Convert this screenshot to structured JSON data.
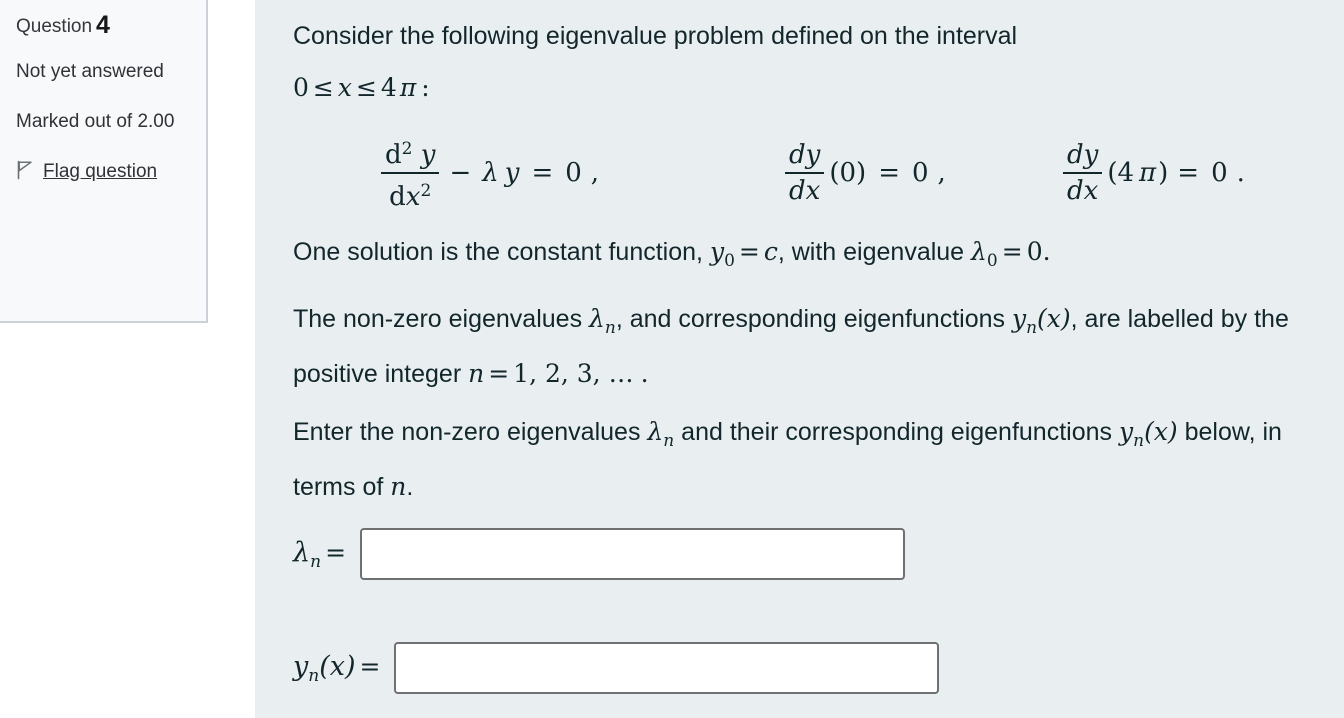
{
  "question_info": {
    "heading_label": "Question",
    "question_number": "4",
    "status": "Not yet answered",
    "marks_label": "Marked out of 2.00",
    "flag_label": "Flag question",
    "flag_icon": "flag-outline-icon"
  },
  "question": {
    "intro_line1": "Consider the following eigenvalue problem defined on the interval",
    "intro_interval": {
      "zero": "0",
      "le1": "≤",
      "x": "x",
      "le2": "≤",
      "four": "4",
      "pi": "π",
      "colon": ":"
    },
    "equations": {
      "ode": {
        "numerator_d": "d",
        "numerator_sup": "2",
        "numerator_y": "y",
        "denominator_d": "d",
        "denominator_x": "x",
        "denominator_sup": "2",
        "minus": "−",
        "lambda": "λ",
        "y": "y",
        "equals": "=",
        "zero": "0",
        "comma": ","
      },
      "bc1": {
        "numerator": "dy",
        "denominator": "dx",
        "arg": "(0)",
        "equals": "=",
        "zero": "0",
        "comma": ","
      },
      "bc2": {
        "numerator": "dy",
        "denominator": "dx",
        "arg_open": "(4",
        "arg_pi": "π",
        "arg_close": ")",
        "equals": "=",
        "zero": "0",
        "period": "."
      }
    },
    "const_solution": {
      "text_before": "One solution is the constant function,",
      "y": "y",
      "y_sub": "0",
      "eq1": "=",
      "c": "c",
      "text_mid": ", with eigenvalue",
      "lambda": "λ",
      "lambda_sub": "0",
      "eq2": "=",
      "zero": "0",
      "period": "."
    },
    "labelling": {
      "text1": "The non-zero eigenvalues",
      "lambda": "λ",
      "lambda_sub": "n",
      "text2": ", and corresponding eigenfunctions",
      "y": "y",
      "y_sub": "n",
      "y_arg": "(x)",
      "text3": ", are labelled by the positive integer",
      "n": "n",
      "equals": "=",
      "list": "1, 2, 3, …",
      "period": "."
    },
    "instruction": {
      "text1": "Enter the non-zero eigenvalues",
      "lambda": "λ",
      "lambda_sub": "n",
      "text2": "and their corresponding eigenfunctions",
      "y": "y",
      "y_sub": "n",
      "y_arg": "(x)",
      "text3": "below, in terms of",
      "n": "n",
      "period": "."
    }
  },
  "answers": {
    "eigenvalue": {
      "label_lambda": "λ",
      "label_sub": "n",
      "label_equals": "=",
      "value": "",
      "placeholder": ""
    },
    "eigenfunction": {
      "label_y": "y",
      "label_sub": "n",
      "label_arg": "(x)",
      "label_equals": "=",
      "value": "",
      "placeholder": ""
    }
  },
  "colors": {
    "panel_background": "#e9eff1",
    "sidebar_background": "#f8f9fa",
    "text": "#12262c",
    "input_border": "#6f7072",
    "sidebar_border": "#ccd1d9"
  }
}
